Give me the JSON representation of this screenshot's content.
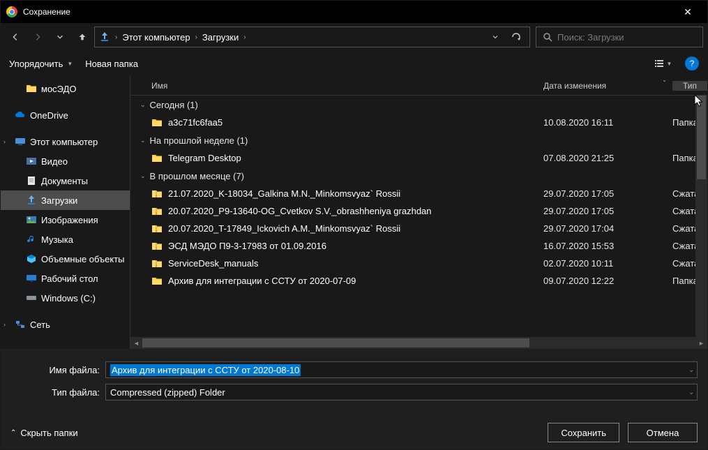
{
  "title": "Сохранение",
  "breadcrumb": {
    "root": "Этот компьютер",
    "loc": "Загрузки"
  },
  "search_placeholder": "Поиск: Загрузки",
  "toolbar": {
    "organize": "Упорядочить",
    "new_folder": "Новая папка"
  },
  "sidebar": [
    {
      "label": "мосЭДО",
      "icon": "folder-y",
      "indent": true
    },
    {
      "label": "OneDrive",
      "icon": "onedrive",
      "spaceAbove": true
    },
    {
      "label": "Этот компьютер",
      "icon": "pc",
      "expandable": true,
      "spaceAbove": true
    },
    {
      "label": "Видео",
      "icon": "video",
      "indent": true
    },
    {
      "label": "Документы",
      "icon": "docs",
      "indent": true
    },
    {
      "label": "Загрузки",
      "icon": "download",
      "indent": true,
      "selected": true
    },
    {
      "label": "Изображения",
      "icon": "images",
      "indent": true
    },
    {
      "label": "Музыка",
      "icon": "music",
      "indent": true
    },
    {
      "label": "Объемные объекты",
      "icon": "3d",
      "indent": true
    },
    {
      "label": "Рабочий стол",
      "icon": "desktop",
      "indent": true
    },
    {
      "label": "Windows (C:)",
      "icon": "drive",
      "indent": true
    },
    {
      "label": "Сеть",
      "icon": "network",
      "expandable": true,
      "spaceAbove": true
    }
  ],
  "columns": {
    "name": "Имя",
    "date": "Дата изменения",
    "type": "Тип"
  },
  "groups": [
    {
      "title": "Сегодня (1)",
      "rows": [
        {
          "name": "a3c71fc6faa5",
          "date": "10.08.2020 16:11",
          "type": "Папка",
          "icon": "folder"
        }
      ]
    },
    {
      "title": "На прошлой неделе (1)",
      "rows": [
        {
          "name": "Telegram Desktop",
          "date": "07.08.2020 21:25",
          "type": "Папка",
          "icon": "folder"
        }
      ]
    },
    {
      "title": "В прошлом месяце (7)",
      "rows": [
        {
          "name": "21.07.2020_K-18034_Galkina M.N._Minkomsvyaz` Rossii",
          "date": "29.07.2020 17:05",
          "type": "Сжатая",
          "icon": "zip"
        },
        {
          "name": "20.07.2020_P9-13640-OG_Cvetkov S.V._obrashheniya grazhdan",
          "date": "29.07.2020 17:05",
          "type": "Сжатая",
          "icon": "zip"
        },
        {
          "name": "20.07.2020_T-17849_Ickovich A.M._Minkomsvyaz` Rossii",
          "date": "29.07.2020 17:04",
          "type": "Сжатая",
          "icon": "zip"
        },
        {
          "name": "ЭСД МЭДО П9-3-17983 от 01.09.2016",
          "date": "16.07.2020 15:53",
          "type": "Сжатая",
          "icon": "zip"
        },
        {
          "name": "ServiceDesk_manuals",
          "date": "02.07.2020 10:11",
          "type": "Сжатая",
          "icon": "zip"
        },
        {
          "name": "Архив для интеграции с ССТУ от 2020-07-09",
          "date": "09.07.2020 12:22",
          "type": "Папка",
          "icon": "folder"
        }
      ]
    }
  ],
  "file_name_label": "Имя файла:",
  "file_name_value": "Архив для интеграции с ССТУ от 2020-08-10",
  "file_type_label": "Тип файла:",
  "file_type_value": "Compressed (zipped) Folder",
  "hide_folders": "Скрыть папки",
  "save_btn": "Сохранить",
  "cancel_btn": "Отмена"
}
